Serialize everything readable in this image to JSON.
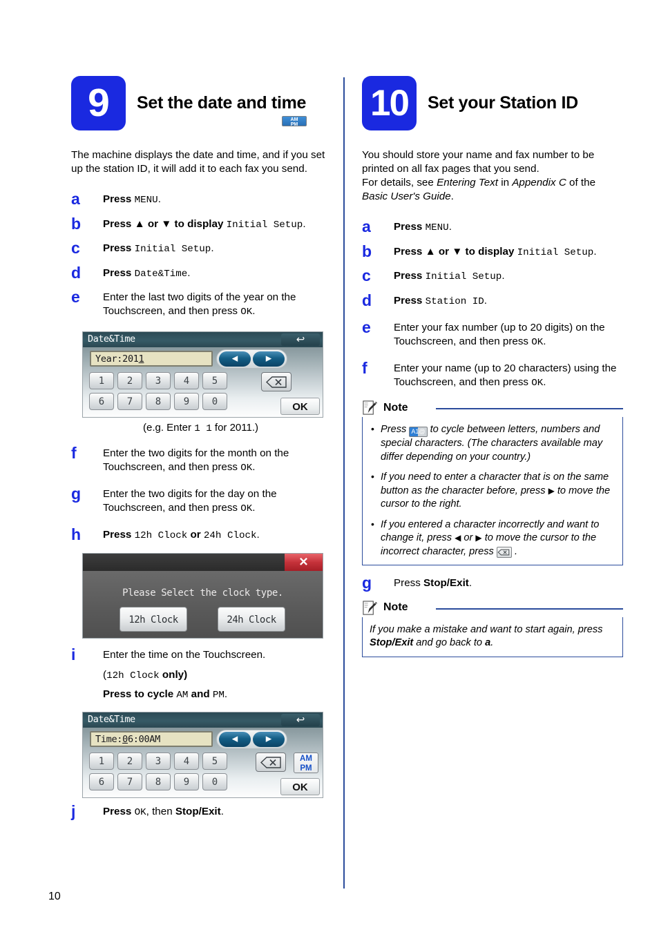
{
  "page": {
    "number": "10"
  },
  "left": {
    "step_number": "9",
    "title": "Set the date and time",
    "intro": "The machine displays the date and time, and if you set up the station ID, it will add it to each fax you send.",
    "steps": {
      "a": {
        "letter": "a",
        "press": "Press",
        "value": "MENU",
        "period": "."
      },
      "b": {
        "letter": "b",
        "text_pre": "Press ▲ or ▼ to display ",
        "value": "Initial Setup",
        "period": "."
      },
      "c": {
        "letter": "c",
        "press": "Press",
        "value": "Initial Setup",
        "period": "."
      },
      "d": {
        "letter": "d",
        "press": "Press",
        "value": "Date&Time",
        "period": "."
      },
      "e": {
        "letter": "e",
        "text_pre": "Enter the last two digits of the year on the Touchscreen, and then press ",
        "value": "OK",
        "period": "."
      },
      "f": {
        "letter": "f",
        "text_pre": "Enter the two digits for the month on the Touchscreen, and then press ",
        "value": "OK",
        "period": "."
      },
      "g": {
        "letter": "g",
        "text_pre": "Enter the two digits for the day on the Touchscreen, and then press ",
        "value": "OK",
        "period": "."
      },
      "h": {
        "letter": "h",
        "press": "Press",
        "value1": "12h Clock",
        "or": " or ",
        "value2": "24h Clock",
        "period": "."
      },
      "i": {
        "letter": "i",
        "text": "Enter the time on the Touchscreen.",
        "note_open": "(",
        "note_mono": "12h Clock",
        "note_close": " only)",
        "press": "Press",
        "cycle_pre": " to cycle ",
        "am": "AM",
        "and": " and ",
        "pm": "PM",
        "period": "."
      },
      "j": {
        "letter": "j",
        "press": "Press ",
        "value": "OK",
        "mid": ", then ",
        "bold": "Stop/Exit",
        "period": "."
      }
    },
    "caption": {
      "pre": "(e.g. Enter ",
      "mono": "1 1",
      "post": " for 2011.)"
    },
    "lcd_year": {
      "title": "Date&Time",
      "field_label": "Year:201",
      "field_cursor": "1",
      "keys_row1": [
        "1",
        "2",
        "3",
        "4",
        "5"
      ],
      "keys_row2": [
        "6",
        "7",
        "8",
        "9",
        "0"
      ],
      "ok_label": "OK",
      "back_icon": "back-arrow-icon",
      "left_icon": "left-arrow-icon",
      "right_icon": "right-arrow-icon",
      "backspace_icon": "backspace-icon"
    },
    "lcd_clock": {
      "message": "Please Select the clock type.",
      "button_12h": "12h Clock",
      "button_24h": "24h Clock",
      "close_icon": "close-icon"
    },
    "lcd_time": {
      "title": "Date&Time",
      "field_pre": "Time:",
      "field_cursor": "0",
      "field_post": "6:00AM",
      "keys_row1": [
        "1",
        "2",
        "3",
        "4",
        "5"
      ],
      "keys_row2": [
        "6",
        "7",
        "8",
        "9",
        "0"
      ],
      "am_label": "AM",
      "pm_label": "PM",
      "ok_label": "OK"
    }
  },
  "right": {
    "step_number": "10",
    "title": "Set your Station ID",
    "intro_line1": "You should store your name and fax number to be printed on all fax pages that you send.",
    "intro_line2_pre": "For details, see ",
    "intro_line2_it1": "Entering Text",
    "intro_line2_mid": " in ",
    "intro_line2_it2": "Appendix C",
    "intro_line2_post": " of the ",
    "intro_line2_it3": "Basic User's Guide",
    "intro_line2_end": ".",
    "steps": {
      "a": {
        "letter": "a",
        "press": "Press",
        "value": "MENU",
        "period": "."
      },
      "b": {
        "letter": "b",
        "text_pre": "Press ▲ or ▼ to display ",
        "value": "Initial Setup",
        "period": "."
      },
      "c": {
        "letter": "c",
        "press": "Press",
        "value": "Initial Setup",
        "period": "."
      },
      "d": {
        "letter": "d",
        "press": "Press",
        "value": "Station ID",
        "period": "."
      },
      "e": {
        "letter": "e",
        "text_pre": "Enter your fax number (up to 20 digits) on the Touchscreen, and then press ",
        "value": "OK",
        "period": "."
      },
      "f": {
        "letter": "f",
        "text_pre": "Enter your name (up to 20 characters) using the Touchscreen, and then press ",
        "value": "OK",
        "period": "."
      },
      "g": {
        "letter": "g",
        "press": "Press ",
        "bold": "Stop/Exit",
        "period": "."
      }
    },
    "note1": {
      "label": "Note",
      "icon": "note-pencil-icon",
      "bullet1_pre": "Press ",
      "bullet1_icon": "a1-at-icon",
      "bullet1_post": " to cycle between letters, numbers and special characters. (The characters available may differ depending on your country.)",
      "bullet2_pre": "If you need to enter a character that is on the same button as the character before, press ",
      "bullet2_arrow": "▶",
      "bullet2_post": " to move the cursor to the right.",
      "bullet3_pre": "If you entered a character incorrectly and want to change it, press ",
      "bullet3_arrow1": "◀",
      "bullet3_mid": " or ",
      "bullet3_arrow2": "▶",
      "bullet3_post": " to move the cursor to the incorrect character, press ",
      "bullet3_icon": "backspace-icon",
      "bullet3_end": " ."
    },
    "note2": {
      "label": "Note",
      "icon": "note-pencil-icon",
      "text_pre": "If you make a mistake and want to start again, press ",
      "text_bold": "Stop/Exit",
      "text_mid": " and go back to ",
      "text_bold2": "a",
      "text_end": "."
    }
  },
  "colors": {
    "accent_blue": "#1a29e0",
    "rule_blue": "#2a4b9b",
    "lcd_header": "#2c4a55",
    "lcd_field": "#e6e2c2",
    "dialog_red": "#c5323a"
  }
}
